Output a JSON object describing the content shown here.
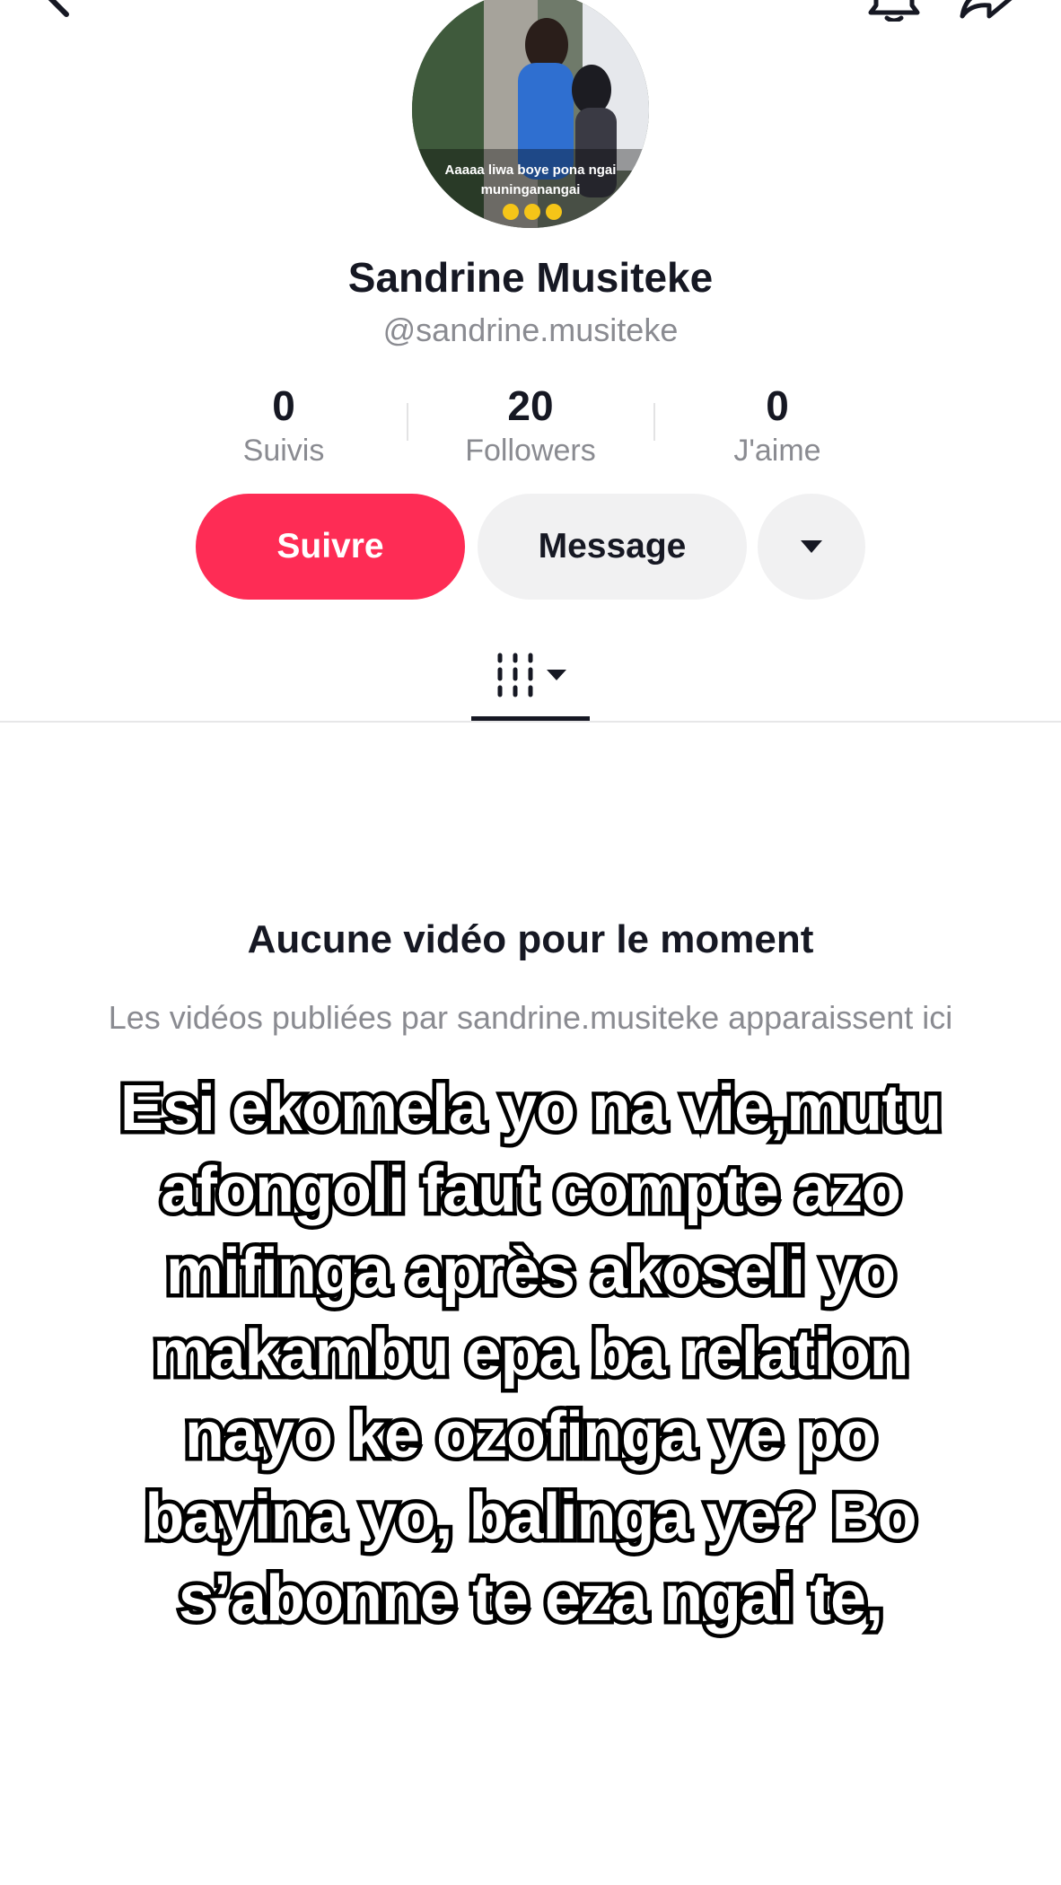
{
  "top_bar": {
    "back_icon": "chevron-left-icon",
    "notification_icon": "bell-icon",
    "share_icon": "share-arrow-icon"
  },
  "profile": {
    "display_name": "Sandrine Musiteke",
    "username": "@sandrine.musiteke",
    "avatar_caption": "Aaaaa liwa boye pona ngai muninganangai"
  },
  "stats": [
    {
      "value": "0",
      "label": "Suivis"
    },
    {
      "value": "20",
      "label": "Followers"
    },
    {
      "value": "0",
      "label": "J'aime"
    }
  ],
  "actions": {
    "follow_label": "Suivre",
    "message_label": "Message",
    "more_icon": "caret-down-icon"
  },
  "tabs": {
    "videos_icon": "video-grid-icon"
  },
  "empty_state": {
    "title": "Aucune vidéo pour le moment",
    "subtitle": "Les vidéos publiées par sandrine.musiteke apparaissent ici"
  },
  "overlay_caption": "Esi ekomela yo na vie,mutu afongoli faut compte azo mifinga après akoseli yo makambu epa ba relation nayo ke ozofinga ye po bayina yo, balinga ye? Bo s’abonne te eza ngai te,",
  "colors": {
    "accent": "#fe2c55",
    "secondary_button": "#f1f1f2",
    "muted_text": "#8a8b91"
  }
}
